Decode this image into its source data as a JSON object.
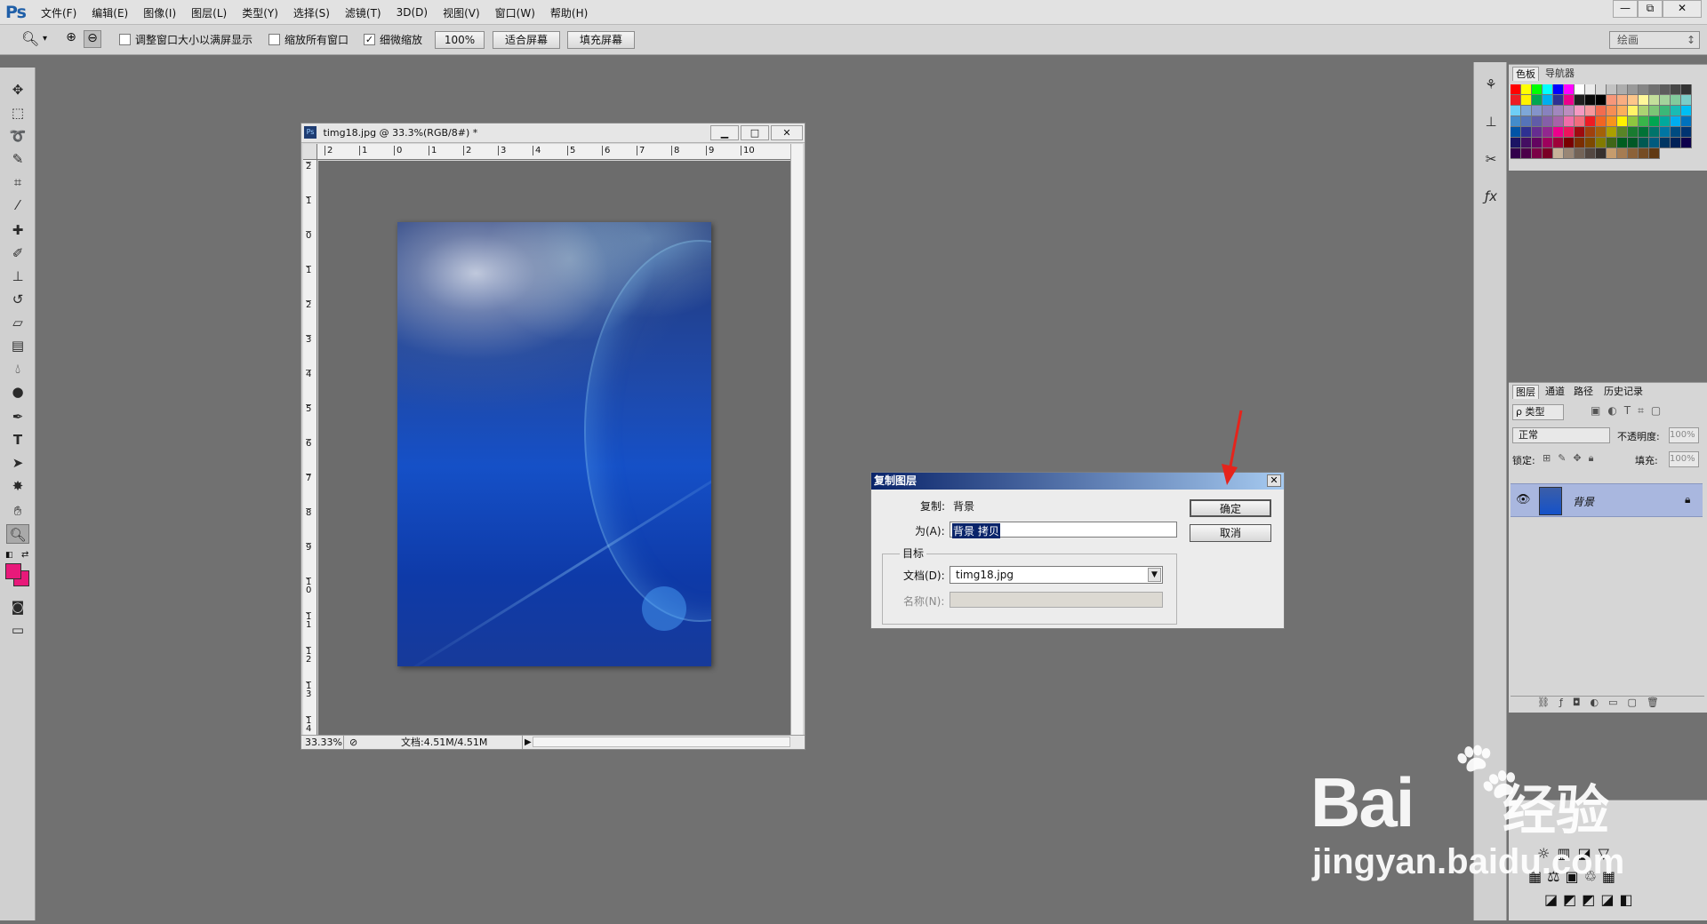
{
  "menubar": {
    "logo": "Ps",
    "items": [
      "文件(F)",
      "编辑(E)",
      "图像(I)",
      "图层(L)",
      "类型(Y)",
      "选择(S)",
      "滤镜(T)",
      "3D(D)",
      "视图(V)",
      "窗口(W)",
      "帮助(H)"
    ],
    "win_min": "—",
    "win_restore": "⧉",
    "win_close": "✕"
  },
  "options": {
    "resize_windows": "调整窗口大小以满屏显示",
    "zoom_all": "缩放所有窗口",
    "scrubby_zoom": "细微缩放",
    "scrubby_checked": "✓",
    "pct100": "100%",
    "fit_screen": "适合屏幕",
    "fill_screen": "填充屏幕",
    "workspace": "绘画"
  },
  "document": {
    "title": "timg18.jpg @ 33.3%(RGB/8#) *",
    "ps_badge": "Ps",
    "zoom": "33.33%",
    "doc_info": "文档:4.51M/4.51M",
    "ruler_top": [
      "2",
      "1",
      "0",
      "1",
      "2",
      "3",
      "4",
      "5",
      "6",
      "7",
      "8",
      "9",
      "10"
    ],
    "ruler_left": [
      "2",
      "1",
      "0",
      "1",
      "2",
      "3",
      "4",
      "5",
      "6",
      "7",
      "8",
      "9",
      "1 0",
      "1 1",
      "1 2",
      "1 3",
      "1 4"
    ]
  },
  "dialog": {
    "title": "复制图层",
    "copy_label": "复制:",
    "copy_value": "背景",
    "as_label": "为(A):",
    "as_value": "背景 拷贝",
    "target_group": "目标",
    "doc_label": "文档(D):",
    "doc_value": "timg18.jpg",
    "name_label": "名称(N):",
    "ok": "确定",
    "cancel": "取消"
  },
  "swatch_panel": {
    "tab1": "色板",
    "tab2": "导航器"
  },
  "layers_panel": {
    "tabs": [
      "图层",
      "通道",
      "路径",
      "历史记录"
    ],
    "filter_kind": "ρ 类型",
    "blend_mode": "正常",
    "opacity_label": "不透明度:",
    "opacity_value": "100%",
    "lock_label": "锁定:",
    "fill_label": "填充:",
    "fill_value": "100%",
    "layer_name": "背景"
  },
  "watermark": {
    "brand_a": "Bai",
    "brand_b": "经验",
    "url": "jingyan.baidu.com"
  },
  "colors": {
    "foreground": "#e8197a",
    "background": "#e8197a",
    "arrow": "#e5241c",
    "dialog_title_start": "#0a246a"
  }
}
